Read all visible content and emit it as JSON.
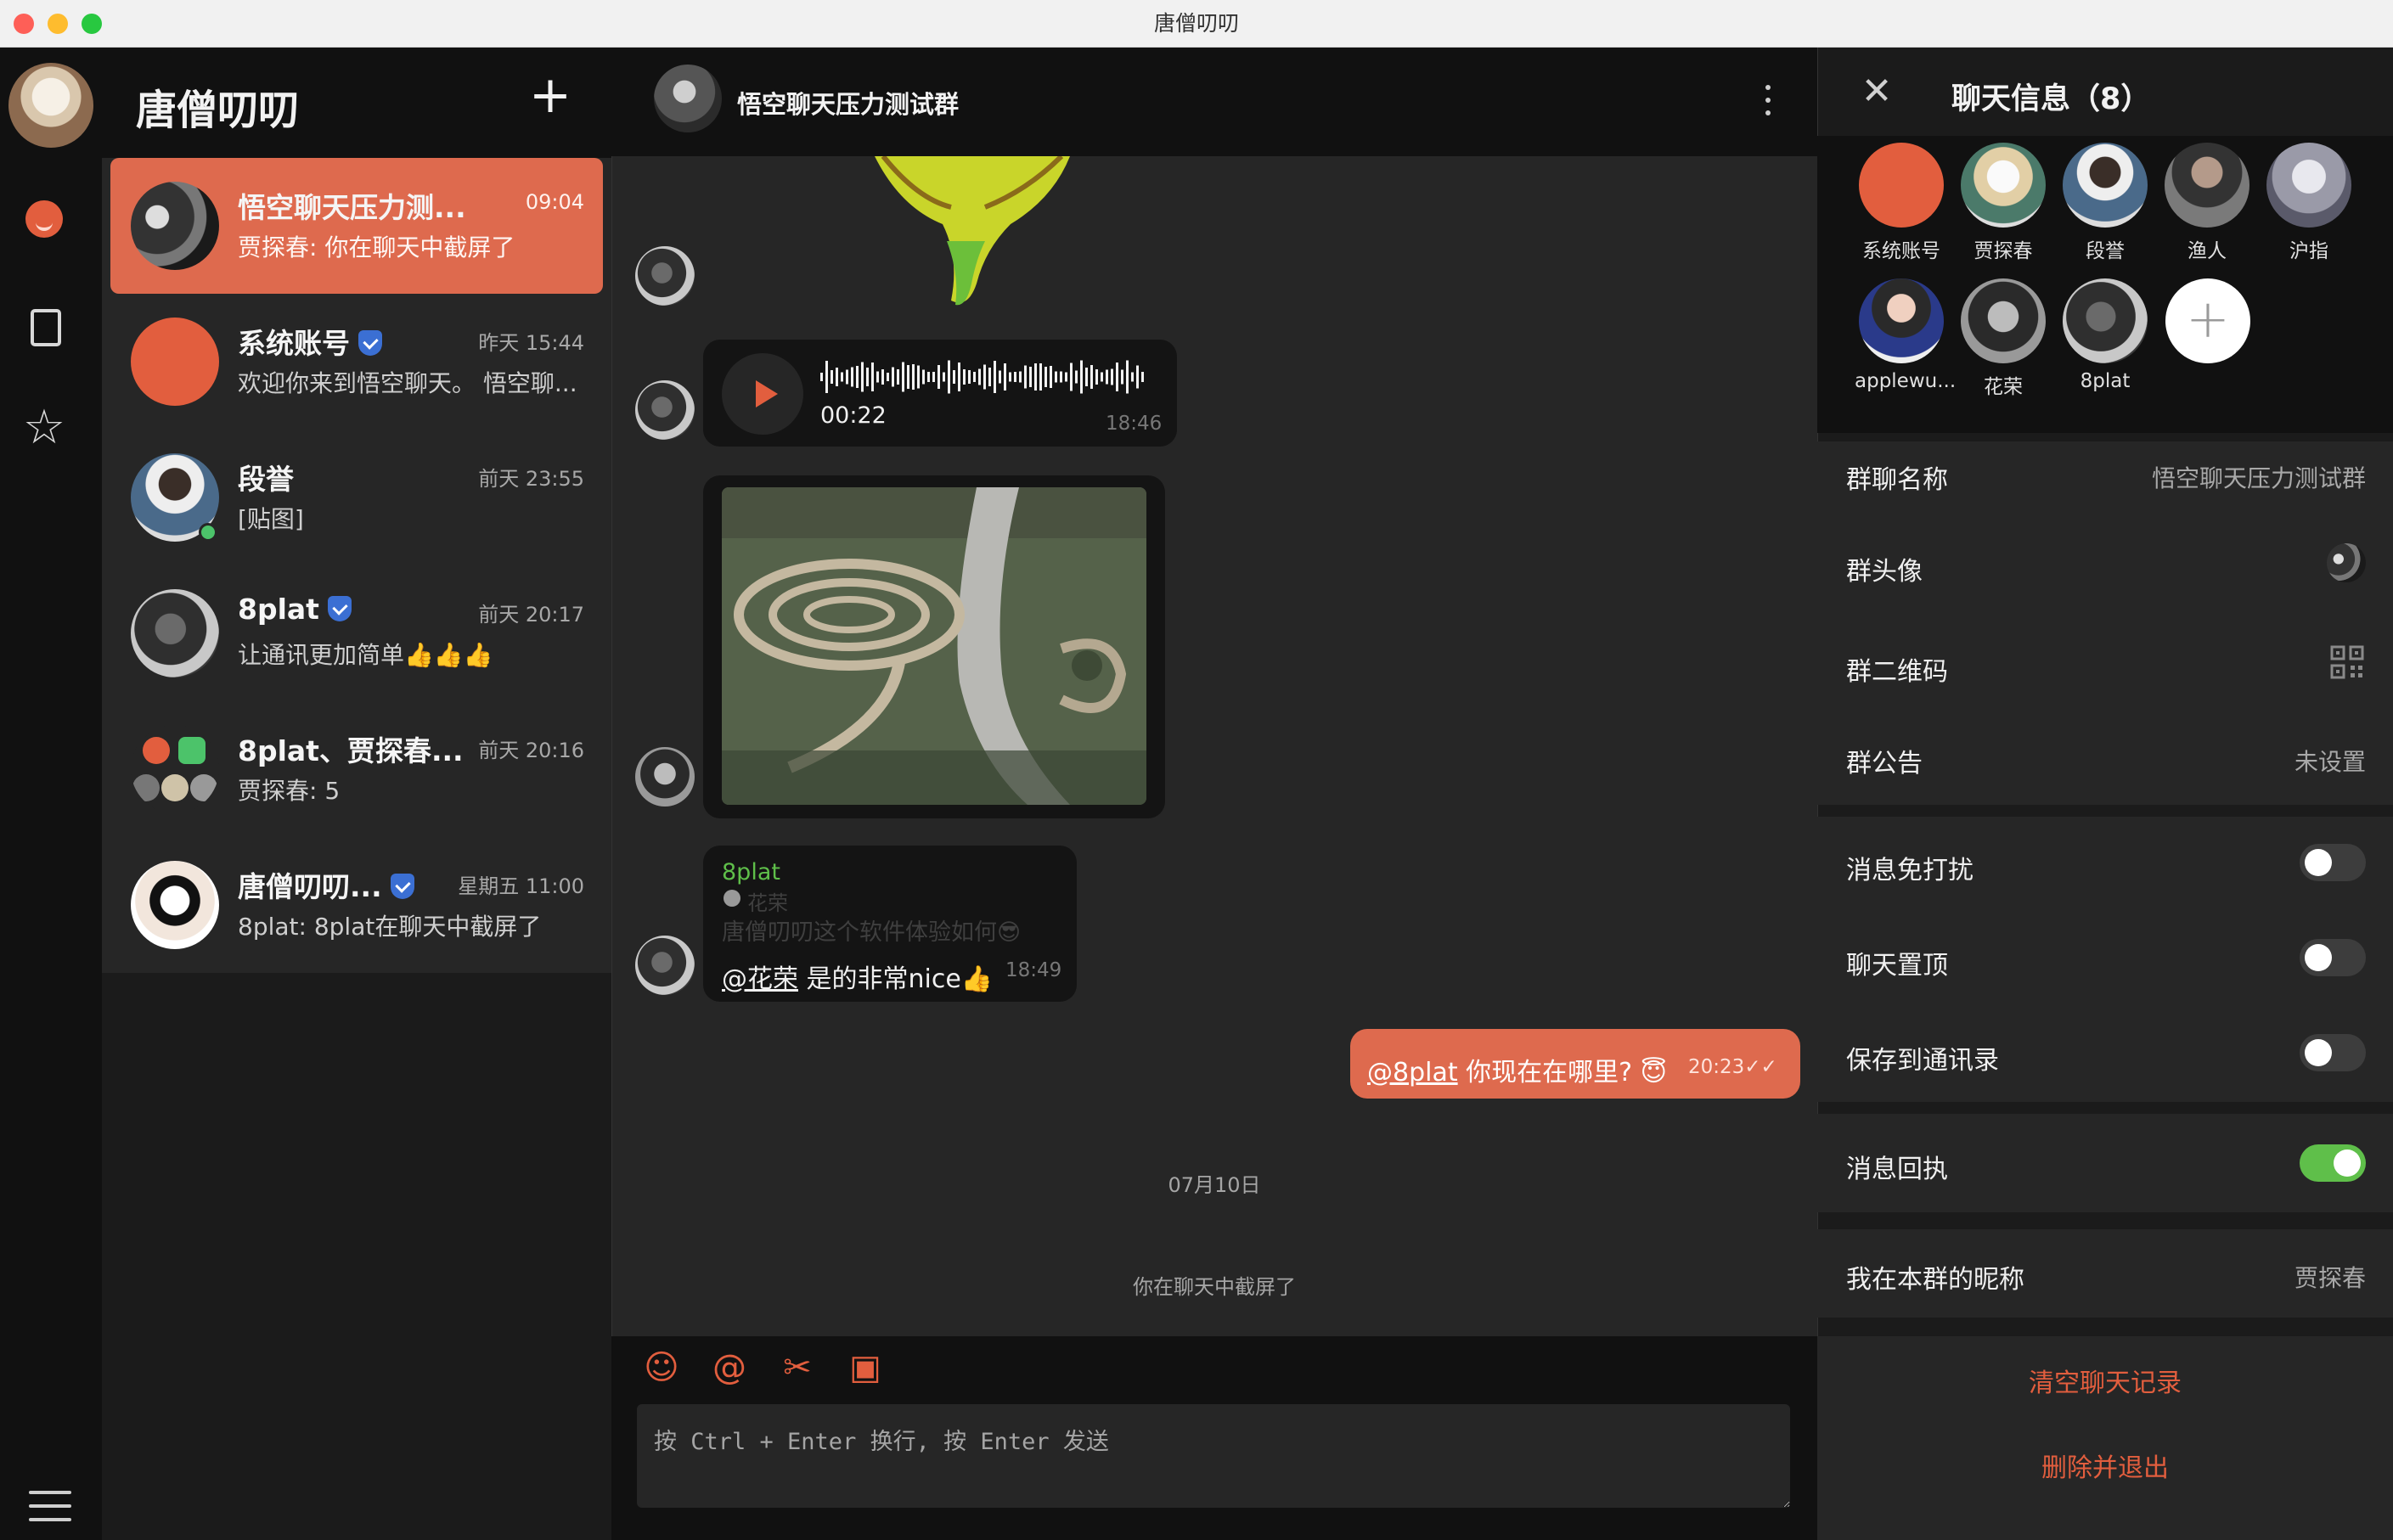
{
  "window": {
    "title": "唐僧叨叨"
  },
  "sidebar": {
    "app_name": "唐僧叨叨",
    "add_icon": "plus-icon"
  },
  "rail": {
    "items": [
      "chat-icon",
      "contacts-icon",
      "star-icon",
      "menu-icon"
    ]
  },
  "conversations": [
    {
      "name": "悟空聊天压力测...",
      "time": "09:04",
      "preview": "贾探春: 你在聊天中截屏了",
      "active": true
    },
    {
      "name": "系统账号",
      "time": "昨天 15:44",
      "preview": "欢迎你来到悟空聊天。 悟空聊...",
      "verified": true
    },
    {
      "name": "段誉",
      "time": "前天 23:55",
      "preview": "[贴图]",
      "online": true
    },
    {
      "name": "8plat",
      "time": "前天 20:17",
      "preview": "让通讯更加简单👍👍👍",
      "verified": true
    },
    {
      "name": "8plat、贾探春...",
      "time": "前天 20:16",
      "preview": "贾探春: 5"
    },
    {
      "name": "唐僧叨叨...",
      "time": "星期五 11:00",
      "preview": "8plat: 8plat在聊天中截屏了",
      "verified": true
    }
  ],
  "chat": {
    "title": "悟空聊天压力测试群",
    "voice": {
      "duration": "00:22",
      "time": "18:46"
    },
    "reply": {
      "sender": "8plat",
      "quote_name": "花荣",
      "quote_text": "唐僧叨叨这个软件体验如何😎",
      "mention": "@花荣",
      "text": " 是的非常nice👍",
      "time": "18:49"
    },
    "own": {
      "mention": "@8plat",
      "text": " 你现在在哪里? 😇",
      "time": "20:23✓✓"
    },
    "date_separator": "07月10日",
    "system_note": "你在聊天中截屏了",
    "toolbar": [
      "emoji-icon",
      "mention-icon",
      "scissors-icon",
      "image-icon"
    ],
    "toolbar_glyphs": [
      "☺",
      "@",
      "✂",
      "▣"
    ],
    "input_placeholder": "按 Ctrl + Enter 换行, 按 Enter 发送"
  },
  "info": {
    "title": "聊天信息（8）",
    "members": [
      "系统账号",
      "贾探春",
      "段誉",
      "渔人",
      "沪指",
      "applewu...",
      "花荣",
      "8plat"
    ],
    "rows": {
      "group_name_label": "群聊名称",
      "group_name_value": "悟空聊天压力测试群",
      "group_avatar_label": "群头像",
      "qr_label": "群二维码",
      "notice_label": "群公告",
      "notice_value": "未设置",
      "mute_label": "消息免打扰",
      "pin_label": "聊天置顶",
      "save_label": "保存到通讯录",
      "receipt_label": "消息回执",
      "nickname_label": "我在本群的昵称",
      "nickname_value": "贾探春"
    },
    "toggles": {
      "mute": false,
      "pin": false,
      "save": false,
      "receipt": true
    },
    "clear_history": "清空聊天记录",
    "delete_exit": "删除并退出"
  },
  "colors": {
    "accent": "#de6a4e",
    "toggle_on": "#5fbf4a",
    "verified": "#3b6fd3"
  }
}
